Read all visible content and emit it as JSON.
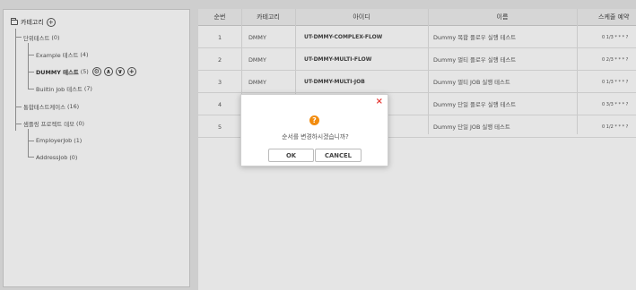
{
  "tree": {
    "root_label": "카테고리",
    "add_symbol": "+",
    "items": [
      {
        "label": "단위테스트",
        "count": "(0)"
      },
      {
        "label": "Example 테스트",
        "count": "(4)"
      },
      {
        "label": "DUMMY 테스트",
        "count": "(5)"
      },
      {
        "label": "Builtin Job 테스트",
        "count": "(7)"
      },
      {
        "label": "통합테스트케이스",
        "count": "(16)"
      },
      {
        "label": "샘플링 프로젝트 데모",
        "count": "(0)"
      },
      {
        "label": "EmployerJob",
        "count": "(1)"
      },
      {
        "label": "AddressJob",
        "count": "(0)"
      }
    ],
    "selected_actions": {
      "settings": "⚙",
      "up": "∧",
      "down": "∨",
      "add": "+"
    }
  },
  "table": {
    "headers": {
      "seq": "순번",
      "category": "카테고리",
      "id": "아이디",
      "name": "이름",
      "schedule": "스케줄 예약"
    },
    "rows": [
      {
        "seq": "1",
        "category": "DMMY",
        "id": "UT-DMMY-COMPLEX-FLOW",
        "name": "Dummy 복합 플로우 실행 테스트",
        "schedule": "0 1/3 * * * ?"
      },
      {
        "seq": "2",
        "category": "DMMY",
        "id": "UT-DMMY-MULTI-FLOW",
        "name": "Dummy 멀티 플로우 실행 테스트",
        "schedule": "0 2/3 * * * ?"
      },
      {
        "seq": "3",
        "category": "DMMY",
        "id": "UT-DMMY-MULTI-JOB",
        "name": "Dummy 멀티 JOB 실행 테스트",
        "schedule": "0 1/3 * * * ?"
      },
      {
        "seq": "4",
        "category": "",
        "id": "",
        "name": "Dummy 단일 플로우 실행 테스트",
        "schedule": "0 3/3 * * * ?"
      },
      {
        "seq": "5",
        "category": "",
        "id": "",
        "name": "Dummy 단일 JOB 실행 테스트",
        "schedule": "0 1/2 * * * ?"
      }
    ]
  },
  "dialog": {
    "icon": "?",
    "message": "순서를 변경하시겠습니까?",
    "ok_label": "OK",
    "cancel_label": "CANCEL",
    "close_symbol": "×"
  },
  "colors": {
    "warning": "#f28c0f",
    "close": "#e53935"
  }
}
